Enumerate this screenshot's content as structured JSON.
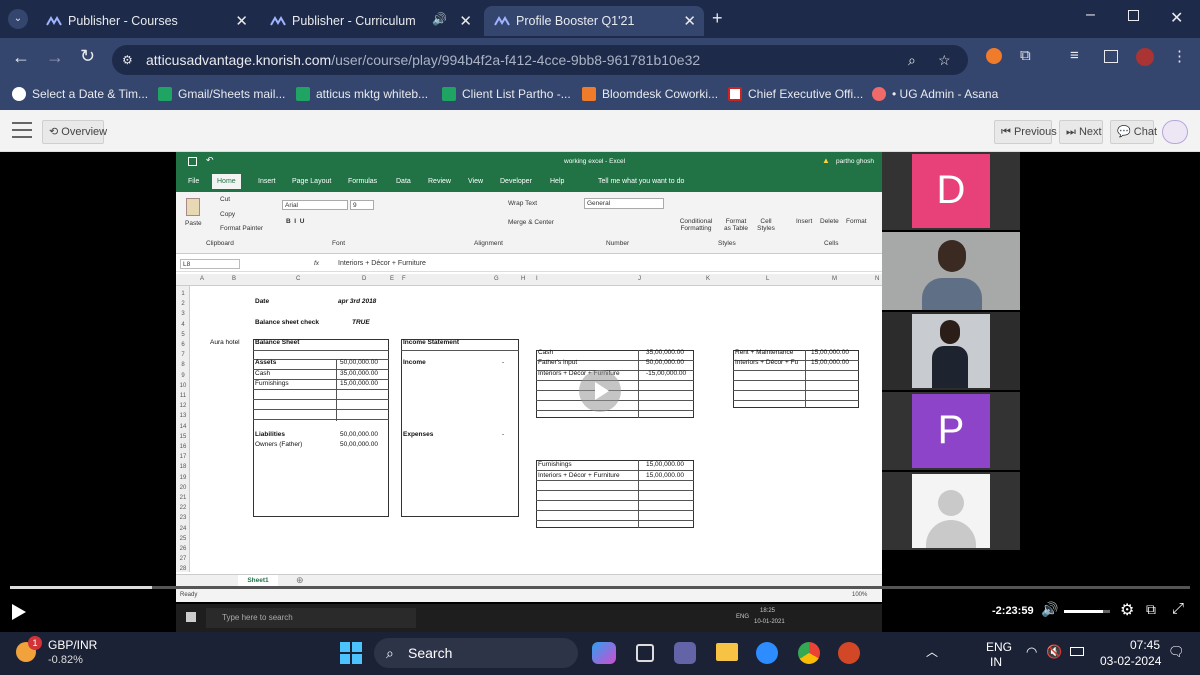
{
  "browser": {
    "tabs": [
      {
        "title": "Publisher - Courses",
        "active": false
      },
      {
        "title": "Publisher - Curriculum",
        "active": false,
        "audio": true
      },
      {
        "title": "Profile Booster Q1'21",
        "active": true
      }
    ],
    "url_host": "atticusadvantage.knorish.com",
    "url_path": "/user/course/play/994b4f2a-f412-4cce-9bb8-961781b10e32",
    "bookmarks": [
      "Select a Date & Tim...",
      "Gmail/Sheets mail...",
      "atticus mktg whiteb...",
      "Client List Partho -...",
      "Bloomdesk Coworki...",
      "Chief Executive Offi...",
      "• UG Admin - Asana"
    ]
  },
  "player": {
    "overview_label": "Overview",
    "previous_label": "Previous",
    "next_label": "Next",
    "chat_label": "Chat",
    "time_remaining": "-2:23:59",
    "progress_fraction": 0.12,
    "volume_fraction": 0.85
  },
  "excel": {
    "title": "working excel - Excel",
    "user": "partho ghosh",
    "tabs": [
      "File",
      "Home",
      "Insert",
      "Page Layout",
      "Formulas",
      "Data",
      "Review",
      "View",
      "Developer",
      "Help",
      "Tell me what you want to do"
    ],
    "groups": [
      "Clipboard",
      "Font",
      "Alignment",
      "Number",
      "Styles",
      "Cells"
    ],
    "clipboard": [
      "Cut",
      "Copy",
      "Format Painter",
      "Paste"
    ],
    "font_name": "Arial",
    "font_size": "9",
    "alignment": [
      "Wrap Text",
      "Merge & Center"
    ],
    "number_format": "General",
    "styles": [
      "Conditional Formatting",
      "Format as Table",
      "Cell Styles"
    ],
    "cells": [
      "Insert",
      "Delete",
      "Format"
    ],
    "name_box": "L8",
    "formula": "Interiors + Décor + Furniture",
    "columns": [
      "A",
      "B",
      "C",
      "D",
      "E",
      "F",
      "G",
      "H",
      "I",
      "J",
      "K",
      "L",
      "M",
      "N"
    ],
    "rows": [
      "1",
      "2",
      "3",
      "4",
      "5",
      "6",
      "7",
      "8",
      "9",
      "10",
      "11",
      "12",
      "13",
      "14",
      "15",
      "16",
      "17",
      "18",
      "19",
      "20",
      "21",
      "22",
      "23",
      "24",
      "25",
      "26",
      "27",
      "28"
    ],
    "cells_text": {
      "date_label": "Date",
      "date_value": "apr 3rd 2018",
      "check_label": "Balance sheet check",
      "check_value": "TRUE",
      "aura": "Aura hotel",
      "bs_title": "Balance Sheet",
      "is_title": "Income Statement",
      "assets": "Assets",
      "cash": "Cash",
      "furnishings": "Furnishings",
      "assets_v": "50,00,000.00",
      "cash_v": "35,00,000.00",
      "furn_v": "15,00,000.00",
      "income": "Income",
      "dash": "-",
      "expenses": "Expenses",
      "liabilities": "Liabilities",
      "owners": "Owners (Father)",
      "liab_v": "50,00,000.00",
      "owners_v": "50,00,000.00",
      "t1_cash": "Cash",
      "t1_cash_v": "35,00,000.00",
      "t1_father": "Father's input",
      "t1_father_v": "50,00,000.00",
      "t1_int": "Interiors + Décor + Furniture",
      "t1_int_v": "-15,00,000.00",
      "t2_rent": "Rent + Maintenance",
      "t2_rent_v": "15,00,000.00",
      "t2_int": "Interiors + Décor + Fu",
      "t2_int_v": "15,00,000.00",
      "t3_furn": "Furnishings",
      "t3_furn_v": "15,00,000.00",
      "t3_int": "Interiors + Décor + Furniture",
      "t3_int_v": "15,00,000.00"
    },
    "sheet_tab": "Sheet1",
    "status": "Ready",
    "zoom": "100%"
  },
  "participants": [
    {
      "type": "letter",
      "letter": "D",
      "color": "#e8417a"
    },
    {
      "type": "video"
    },
    {
      "type": "video"
    },
    {
      "type": "letter",
      "letter": "P",
      "color": "#8e44c8"
    },
    {
      "type": "avatar"
    }
  ],
  "inner_taskbar": {
    "search_placeholder": "Type here to search",
    "time": "18:25",
    "date": "10-01-2021",
    "lang": "ENG"
  },
  "taskbar": {
    "ticker_name": "GBP/INR",
    "ticker_change": "-0.82%",
    "ticker_badge": "1",
    "search_label": "Search",
    "lang_top": "ENG",
    "lang_bottom": "IN",
    "time": "07:45",
    "date": "03-02-2024"
  }
}
